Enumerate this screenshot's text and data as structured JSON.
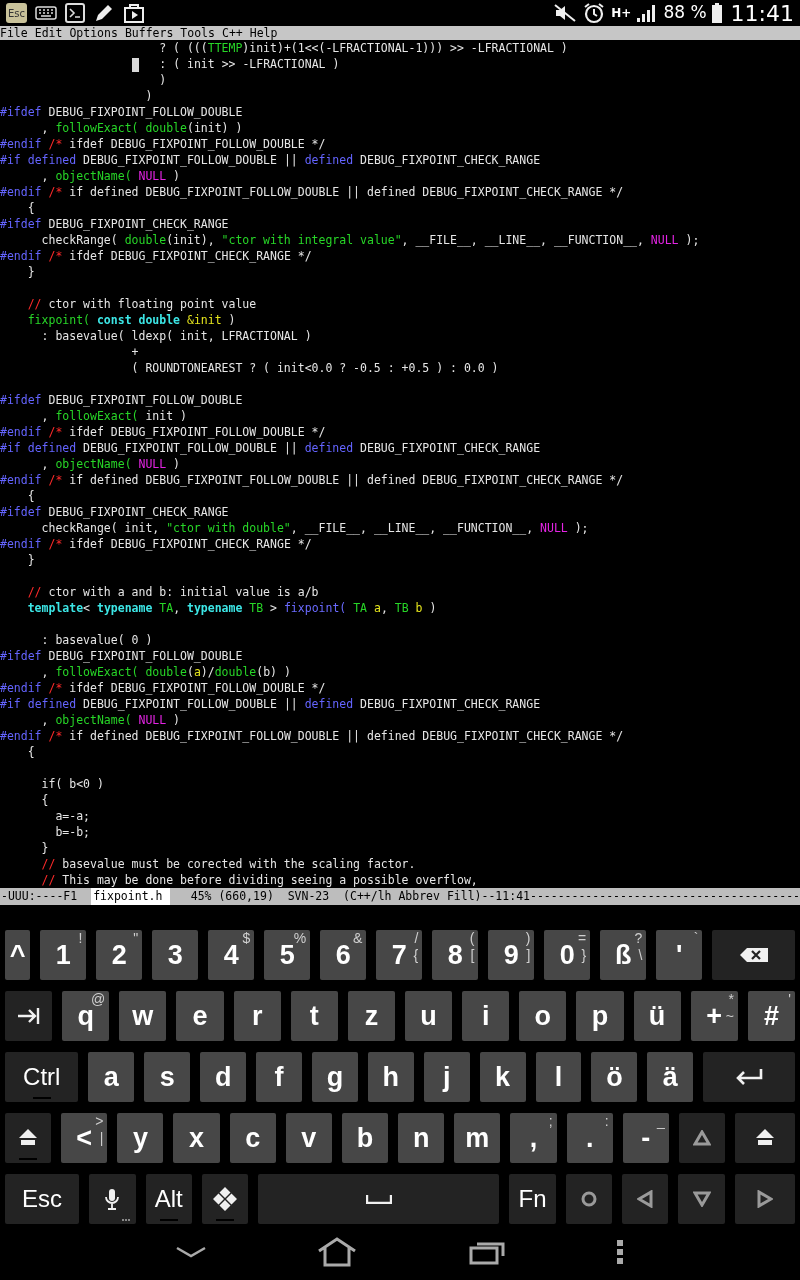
{
  "status_bar": {
    "esc_badge": "Esc",
    "network": "H+",
    "battery_text": "88 %",
    "time": "11:41"
  },
  "menu_bar": [
    "File",
    "Edit",
    "Options",
    "Buffers",
    "Tools",
    "C++",
    "Help"
  ],
  "editor": {
    "lines": [
      {
        "kind": "code",
        "segments": [
          {
            "kind": "plain",
            "text": "                       ? ( ((("
          },
          {
            "kind": "type",
            "text": "TTEMP"
          },
          {
            "kind": "plain",
            "text": ")init)+(1<<(-LFRACTIONAL-1))) >> -LFRACTIONAL )"
          }
        ]
      },
      {
        "kind": "code",
        "segments": [
          {
            "kind": "cursor"
          },
          {
            "kind": "plain",
            "text": "   : ( init >> -LFRACTIONAL )"
          }
        ]
      },
      {
        "kind": "code",
        "segments": [
          {
            "kind": "plain",
            "text": "                       )"
          }
        ]
      },
      {
        "kind": "code",
        "segments": [
          {
            "kind": "plain",
            "text": "                     )"
          }
        ]
      },
      {
        "kind": "code",
        "segments": [
          {
            "kind": "preproc",
            "text": "#ifdef"
          },
          {
            "kind": "plain",
            "text": " DEBUG_FIXPOINT_FOLLOW_DOUBLE"
          }
        ]
      },
      {
        "kind": "code",
        "segments": [
          {
            "kind": "plain",
            "text": "      , "
          },
          {
            "kind": "function",
            "text": "followExact("
          },
          {
            "kind": "type",
            "text": " double"
          },
          {
            "kind": "plain",
            "text": "(init) )"
          }
        ]
      },
      {
        "kind": "code",
        "segments": [
          {
            "kind": "preproc",
            "text": "#endif"
          },
          {
            "kind": "comment",
            "text": " /*"
          },
          {
            "kind": "plain",
            "text": " ifdef DEBUG_FIXPOINT_FOLLOW_DOUBLE */"
          }
        ]
      },
      {
        "kind": "code",
        "segments": [
          {
            "kind": "preproc",
            "text": "#if"
          },
          {
            "kind": "preproc",
            "text": " defined"
          },
          {
            "kind": "plain",
            "text": " DEBUG_FIXPOINT_FOLLOW_DOUBLE || "
          },
          {
            "kind": "preproc",
            "text": "defined"
          },
          {
            "kind": "plain",
            "text": " DEBUG_FIXPOINT_CHECK_RANGE"
          }
        ]
      },
      {
        "kind": "code",
        "segments": [
          {
            "kind": "plain",
            "text": "      , "
          },
          {
            "kind": "function",
            "text": "objectName("
          },
          {
            "kind": "constant",
            "text": " NULL"
          },
          {
            "kind": "plain",
            "text": " )"
          }
        ]
      },
      {
        "kind": "code",
        "segments": [
          {
            "kind": "preproc",
            "text": "#endif"
          },
          {
            "kind": "comment",
            "text": " /*"
          },
          {
            "kind": "plain",
            "text": " if defined DEBUG_FIXPOINT_FOLLOW_DOUBLE || defined DEBUG_FIXPOINT_CHECK_RANGE */"
          }
        ]
      },
      {
        "kind": "code",
        "segments": [
          {
            "kind": "plain",
            "text": "    {"
          }
        ]
      },
      {
        "kind": "code",
        "segments": [
          {
            "kind": "preproc",
            "text": "#ifdef"
          },
          {
            "kind": "plain",
            "text": " DEBUG_FIXPOINT_CHECK_RANGE"
          }
        ]
      },
      {
        "kind": "code",
        "segments": [
          {
            "kind": "plain",
            "text": "      checkRange( "
          },
          {
            "kind": "type",
            "text": "double"
          },
          {
            "kind": "plain",
            "text": "(init), "
          },
          {
            "kind": "string",
            "text": "\"ctor with integral value\""
          },
          {
            "kind": "plain",
            "text": ", __FILE__, __LINE__, __FUNCTION__, "
          },
          {
            "kind": "constant",
            "text": "NULL"
          },
          {
            "kind": "plain",
            "text": " );"
          }
        ]
      },
      {
        "kind": "code",
        "segments": [
          {
            "kind": "preproc",
            "text": "#endif"
          },
          {
            "kind": "comment",
            "text": " /*"
          },
          {
            "kind": "plain",
            "text": " ifdef DEBUG_FIXPOINT_CHECK_RANGE */"
          }
        ]
      },
      {
        "kind": "code",
        "segments": [
          {
            "kind": "plain",
            "text": "    }"
          }
        ]
      },
      {
        "kind": "blank"
      },
      {
        "kind": "code",
        "segments": [
          {
            "kind": "comment",
            "text": "    //"
          },
          {
            "kind": "plain",
            "text": " ctor with floating point value"
          }
        ]
      },
      {
        "kind": "code",
        "segments": [
          {
            "kind": "function",
            "text": "    fixpoint("
          },
          {
            "kind": "keyword",
            "text": " const double"
          },
          {
            "kind": "variable",
            "text": " &init"
          },
          {
            "kind": "plain",
            "text": " )"
          }
        ]
      },
      {
        "kind": "code",
        "segments": [
          {
            "kind": "plain",
            "text": "      : basevalue( ldexp( init, LFRACTIONAL )"
          }
        ]
      },
      {
        "kind": "code",
        "segments": [
          {
            "kind": "plain",
            "text": "                   +"
          }
        ]
      },
      {
        "kind": "code",
        "segments": [
          {
            "kind": "plain",
            "text": "                   ( ROUNDTONEAREST ? ( init<0.0 ? -0.5 : +0.5 ) : 0.0 )"
          }
        ]
      },
      {
        "kind": "blank"
      },
      {
        "kind": "code",
        "segments": [
          {
            "kind": "preproc",
            "text": "#ifdef"
          },
          {
            "kind": "plain",
            "text": " DEBUG_FIXPOINT_FOLLOW_DOUBLE"
          }
        ]
      },
      {
        "kind": "code",
        "segments": [
          {
            "kind": "plain",
            "text": "      , "
          },
          {
            "kind": "function",
            "text": "followExact("
          },
          {
            "kind": "plain",
            "text": " init )"
          }
        ]
      },
      {
        "kind": "code",
        "segments": [
          {
            "kind": "preproc",
            "text": "#endif"
          },
          {
            "kind": "comment",
            "text": " /*"
          },
          {
            "kind": "plain",
            "text": " ifdef DEBUG_FIXPOINT_FOLLOW_DOUBLE */"
          }
        ]
      },
      {
        "kind": "code",
        "segments": [
          {
            "kind": "preproc",
            "text": "#if"
          },
          {
            "kind": "preproc",
            "text": " defined"
          },
          {
            "kind": "plain",
            "text": " DEBUG_FIXPOINT_FOLLOW_DOUBLE || "
          },
          {
            "kind": "preproc",
            "text": "defined"
          },
          {
            "kind": "plain",
            "text": " DEBUG_FIXPOINT_CHECK_RANGE"
          }
        ]
      },
      {
        "kind": "code",
        "segments": [
          {
            "kind": "plain",
            "text": "      , "
          },
          {
            "kind": "function",
            "text": "objectName("
          },
          {
            "kind": "constant",
            "text": " NULL"
          },
          {
            "kind": "plain",
            "text": " )"
          }
        ]
      },
      {
        "kind": "code",
        "segments": [
          {
            "kind": "preproc",
            "text": "#endif"
          },
          {
            "kind": "comment",
            "text": " /*"
          },
          {
            "kind": "plain",
            "text": " if defined DEBUG_FIXPOINT_FOLLOW_DOUBLE || defined DEBUG_FIXPOINT_CHECK_RANGE */"
          }
        ]
      },
      {
        "kind": "code",
        "segments": [
          {
            "kind": "plain",
            "text": "    {"
          }
        ]
      },
      {
        "kind": "code",
        "segments": [
          {
            "kind": "preproc",
            "text": "#ifdef"
          },
          {
            "kind": "plain",
            "text": " DEBUG_FIXPOINT_CHECK_RANGE"
          }
        ]
      },
      {
        "kind": "code",
        "segments": [
          {
            "kind": "plain",
            "text": "      checkRange( init, "
          },
          {
            "kind": "string",
            "text": "\"ctor with double\""
          },
          {
            "kind": "plain",
            "text": ", __FILE__, __LINE__, __FUNCTION__, "
          },
          {
            "kind": "constant",
            "text": "NULL"
          },
          {
            "kind": "plain",
            "text": " );"
          }
        ]
      },
      {
        "kind": "code",
        "segments": [
          {
            "kind": "preproc",
            "text": "#endif"
          },
          {
            "kind": "comment",
            "text": " /*"
          },
          {
            "kind": "plain",
            "text": " ifdef DEBUG_FIXPOINT_CHECK_RANGE */"
          }
        ]
      },
      {
        "kind": "code",
        "segments": [
          {
            "kind": "plain",
            "text": "    }"
          }
        ]
      },
      {
        "kind": "blank"
      },
      {
        "kind": "code",
        "segments": [
          {
            "kind": "comment",
            "text": "    //"
          },
          {
            "kind": "plain",
            "text": " ctor with a and b: initial value is a/b"
          }
        ]
      },
      {
        "kind": "code",
        "segments": [
          {
            "kind": "keyword",
            "text": "    template"
          },
          {
            "kind": "plain",
            "text": "< "
          },
          {
            "kind": "keyword",
            "text": "typename"
          },
          {
            "kind": "type",
            "text": " TA"
          },
          {
            "kind": "plain",
            "text": ", "
          },
          {
            "kind": "keyword",
            "text": "typename"
          },
          {
            "kind": "type",
            "text": " TB"
          },
          {
            "kind": "plain",
            "text": " > "
          },
          {
            "kind": "funcname",
            "text": "fixpoint("
          },
          {
            "kind": "type",
            "text": " TA"
          },
          {
            "kind": "variable",
            "text": " a"
          },
          {
            "kind": "plain",
            "text": ", "
          },
          {
            "kind": "type",
            "text": "TB"
          },
          {
            "kind": "variable",
            "text": " b"
          },
          {
            "kind": "plain",
            "text": " )"
          }
        ]
      },
      {
        "kind": "blank"
      },
      {
        "kind": "code",
        "segments": [
          {
            "kind": "plain",
            "text": "      : basevalue( 0 )"
          }
        ]
      },
      {
        "kind": "code",
        "segments": [
          {
            "kind": "preproc",
            "text": "#ifdef"
          },
          {
            "kind": "plain",
            "text": " DEBUG_FIXPOINT_FOLLOW_DOUBLE"
          }
        ]
      },
      {
        "kind": "code",
        "segments": [
          {
            "kind": "plain",
            "text": "      , "
          },
          {
            "kind": "function",
            "text": "followExact("
          },
          {
            "kind": "type",
            "text": " double"
          },
          {
            "kind": "plain",
            "text": "("
          },
          {
            "kind": "variable",
            "text": "a"
          },
          {
            "kind": "plain",
            "text": ")/"
          },
          {
            "kind": "type",
            "text": "double"
          },
          {
            "kind": "plain",
            "text": "(b) )"
          }
        ]
      },
      {
        "kind": "code",
        "segments": [
          {
            "kind": "preproc",
            "text": "#endif"
          },
          {
            "kind": "comment",
            "text": " /*"
          },
          {
            "kind": "plain",
            "text": " ifdef DEBUG_FIXPOINT_FOLLOW_DOUBLE */"
          }
        ]
      },
      {
        "kind": "code",
        "segments": [
          {
            "kind": "preproc",
            "text": "#if"
          },
          {
            "kind": "preproc",
            "text": " defined"
          },
          {
            "kind": "plain",
            "text": " DEBUG_FIXPOINT_FOLLOW_DOUBLE || "
          },
          {
            "kind": "preproc",
            "text": "defined"
          },
          {
            "kind": "plain",
            "text": " DEBUG_FIXPOINT_CHECK_RANGE"
          }
        ]
      },
      {
        "kind": "code",
        "segments": [
          {
            "kind": "plain",
            "text": "      , "
          },
          {
            "kind": "function",
            "text": "objectName("
          },
          {
            "kind": "constant",
            "text": " NULL"
          },
          {
            "kind": "plain",
            "text": " )"
          }
        ]
      },
      {
        "kind": "code",
        "segments": [
          {
            "kind": "preproc",
            "text": "#endif"
          },
          {
            "kind": "comment",
            "text": " /*"
          },
          {
            "kind": "plain",
            "text": " if defined DEBUG_FIXPOINT_FOLLOW_DOUBLE || defined DEBUG_FIXPOINT_CHECK_RANGE */"
          }
        ]
      },
      {
        "kind": "code",
        "segments": [
          {
            "kind": "plain",
            "text": "    {"
          }
        ]
      },
      {
        "kind": "blank"
      },
      {
        "kind": "code",
        "segments": [
          {
            "kind": "plain",
            "text": "      if( b<0 )"
          }
        ]
      },
      {
        "kind": "code",
        "segments": [
          {
            "kind": "plain",
            "text": "      {"
          }
        ]
      },
      {
        "kind": "code",
        "segments": [
          {
            "kind": "plain",
            "text": "        a=-a;"
          }
        ]
      },
      {
        "kind": "code",
        "segments": [
          {
            "kind": "plain",
            "text": "        b=-b;"
          }
        ]
      },
      {
        "kind": "code",
        "segments": [
          {
            "kind": "plain",
            "text": "      }"
          }
        ]
      },
      {
        "kind": "code",
        "segments": [
          {
            "kind": "comment",
            "text": "      //"
          },
          {
            "kind": "plain",
            "text": " basevalue must be corected with the scaling factor."
          }
        ]
      },
      {
        "kind": "code",
        "segments": [
          {
            "kind": "comment",
            "text": "      //"
          },
          {
            "kind": "plain",
            "text": " This may be done before dividing seeing a possible overflow,"
          }
        ]
      }
    ]
  },
  "mode_line": {
    "prefix": "-UUU:----F1",
    "buffer": "fixpoint.h",
    "info": "45% (660,19)  SVN-23  (C++/lh Abbrev Fill)--11:41---------------------------------------"
  },
  "keyboard": {
    "rows": [
      [
        {
          "kind": "narrow",
          "label": "^"
        },
        {
          "kind": "char",
          "label": "1",
          "hint": "!"
        },
        {
          "kind": "char",
          "label": "2",
          "hint": "\""
        },
        {
          "kind": "char",
          "label": "3"
        },
        {
          "kind": "char",
          "label": "4",
          "hint": "$"
        },
        {
          "kind": "char",
          "label": "5",
          "hint": "%"
        },
        {
          "kind": "char",
          "label": "6",
          "hint": "&"
        },
        {
          "kind": "char",
          "label": "7",
          "hint": "/",
          "hint_lower": "{"
        },
        {
          "kind": "char",
          "label": "8",
          "hint": "(",
          "hint_lower": "["
        },
        {
          "kind": "char",
          "label": "9",
          "hint": ")",
          "hint_lower": "]"
        },
        {
          "kind": "char",
          "label": "0",
          "hint": "=",
          "hint_lower": "}"
        },
        {
          "kind": "char",
          "label": "ß",
          "hint": "?",
          "hint_lower": "\\"
        },
        {
          "kind": "char",
          "label": "'",
          "hint": "`"
        },
        {
          "kind": "backspace"
        }
      ],
      [
        {
          "kind": "tab"
        },
        {
          "kind": "char",
          "label": "q",
          "hint": "@"
        },
        {
          "kind": "char",
          "label": "w"
        },
        {
          "kind": "char",
          "label": "e"
        },
        {
          "kind": "char",
          "label": "r"
        },
        {
          "kind": "char",
          "label": "t"
        },
        {
          "kind": "char",
          "label": "z"
        },
        {
          "kind": "char",
          "label": "u"
        },
        {
          "kind": "char",
          "label": "i"
        },
        {
          "kind": "char",
          "label": "o"
        },
        {
          "kind": "char",
          "label": "p"
        },
        {
          "kind": "char",
          "label": "ü"
        },
        {
          "kind": "char",
          "label": "+",
          "hint": "*",
          "hint_lower": "~"
        },
        {
          "kind": "char",
          "label": "#",
          "hint": "'"
        }
      ],
      [
        {
          "kind": "ctrl",
          "label": "Ctrl"
        },
        {
          "kind": "char",
          "label": "a"
        },
        {
          "kind": "char",
          "label": "s"
        },
        {
          "kind": "char",
          "label": "d"
        },
        {
          "kind": "char",
          "label": "f"
        },
        {
          "kind": "char",
          "label": "g"
        },
        {
          "kind": "char",
          "label": "h"
        },
        {
          "kind": "char",
          "label": "j"
        },
        {
          "kind": "char",
          "label": "k"
        },
        {
          "kind": "char",
          "label": "l"
        },
        {
          "kind": "char",
          "label": "ö"
        },
        {
          "kind": "char",
          "label": "ä"
        },
        {
          "kind": "enter"
        }
      ],
      [
        {
          "kind": "shift"
        },
        {
          "kind": "char",
          "label": "<",
          "hint": ">",
          "hint_lower": "|"
        },
        {
          "kind": "char",
          "label": "y"
        },
        {
          "kind": "char",
          "label": "x"
        },
        {
          "kind": "char",
          "label": "c"
        },
        {
          "kind": "char",
          "label": "v"
        },
        {
          "kind": "char",
          "label": "b"
        },
        {
          "kind": "char",
          "label": "n"
        },
        {
          "kind": "char",
          "label": "m"
        },
        {
          "kind": "char",
          "label": ",",
          "hint": ";"
        },
        {
          "kind": "char",
          "label": ".",
          "hint": ":"
        },
        {
          "kind": "char",
          "label": "-",
          "hint": "_"
        },
        {
          "kind": "up"
        },
        {
          "kind": "shift-right"
        }
      ],
      [
        {
          "kind": "esc",
          "label": "Esc"
        },
        {
          "kind": "mic"
        },
        {
          "kind": "alt",
          "label": "Alt"
        },
        {
          "kind": "meta"
        },
        {
          "kind": "space"
        },
        {
          "kind": "fn",
          "label": "Fn"
        },
        {
          "kind": "circle"
        },
        {
          "kind": "left"
        },
        {
          "kind": "down"
        },
        {
          "kind": "right"
        }
      ]
    ]
  }
}
